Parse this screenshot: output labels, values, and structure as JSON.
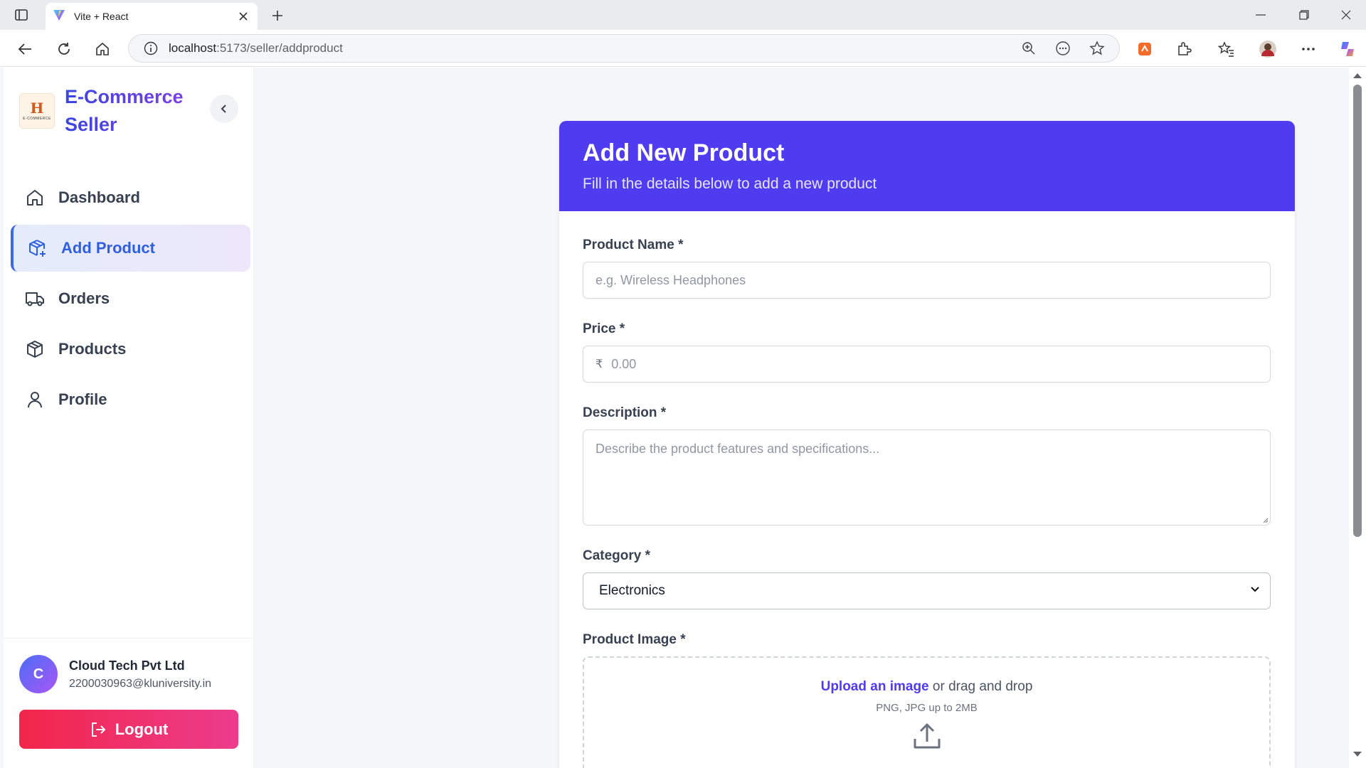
{
  "browser": {
    "tab_title": "Vite + React",
    "url_host": "localhost",
    "url_path": ":5173/seller/addproduct"
  },
  "sidebar": {
    "brand_line1": "E-Commerce",
    "brand_line2": "Seller",
    "logo_text": "H",
    "logo_caption": "E-COMMERCE",
    "items": [
      {
        "label": "Dashboard",
        "icon": "home-icon",
        "active": false
      },
      {
        "label": "Add Product",
        "icon": "package-plus-icon",
        "active": true
      },
      {
        "label": "Orders",
        "icon": "truck-icon",
        "active": false
      },
      {
        "label": "Products",
        "icon": "box-icon",
        "active": false
      },
      {
        "label": "Profile",
        "icon": "user-icon",
        "active": false
      }
    ],
    "user": {
      "initial": "C",
      "name": "Cloud Tech Pvt Ltd",
      "email": "2200030963@kluniversity.in"
    },
    "logout_label": "Logout"
  },
  "form": {
    "title": "Add New Product",
    "subtitle": "Fill in the details below to add a new product",
    "name_label": "Product Name *",
    "name_placeholder": "e.g. Wireless Headphones",
    "price_label": "Price *",
    "price_currency": "₹",
    "price_placeholder": "0.00",
    "description_label": "Description *",
    "description_placeholder": "Describe the product features and specifications...",
    "category_label": "Category *",
    "category_value": "Electronics",
    "image_label": "Product Image *",
    "upload_link": "Upload an image",
    "upload_text": " or drag and drop",
    "upload_hint": "PNG, JPG up to 2MB"
  },
  "colors": {
    "header": "#4f3bf0",
    "active_nav": "#2f5fe0",
    "logout": "#f2264b"
  }
}
